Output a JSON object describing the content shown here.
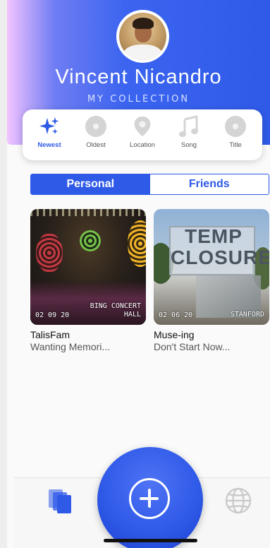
{
  "profile": {
    "name": "Vincent Nicandro",
    "subtitle": "MY COLLECTION"
  },
  "sort_options": [
    {
      "label": "Newest",
      "icon": "sparkle-icon",
      "active": true
    },
    {
      "label": "Oldest",
      "icon": "record-icon",
      "active": false
    },
    {
      "label": "Location",
      "icon": "location-pin-icon",
      "active": false
    },
    {
      "label": "Song",
      "icon": "music-note-icon",
      "active": false
    },
    {
      "label": "Title",
      "icon": "record-icon",
      "active": false
    }
  ],
  "tabs": {
    "personal": "Personal",
    "friends": "Friends",
    "selected": "Personal"
  },
  "cards": [
    {
      "date": "02 09 20",
      "location": "BING CONCERT HALL",
      "location_line1": "BING CONCERT",
      "location_line2": "HALL",
      "title": "TalisFam",
      "subtitle": "Wanting Memori..."
    },
    {
      "date": "02 06 20",
      "location": "STANFORD",
      "location_line1": "STANFORD",
      "location_line2": "",
      "title": "Muse-ing",
      "subtitle": "Don't Start Now..."
    }
  ],
  "sign_photo_text": "TEMP CLOSURE",
  "bottom_nav": {
    "collection_icon": "collection-stack-icon",
    "add_icon": "add-circle-icon",
    "globe_icon": "globe-icon"
  },
  "colors": {
    "accent": "#2f5ae8",
    "inactive": "#d4d4d4"
  }
}
